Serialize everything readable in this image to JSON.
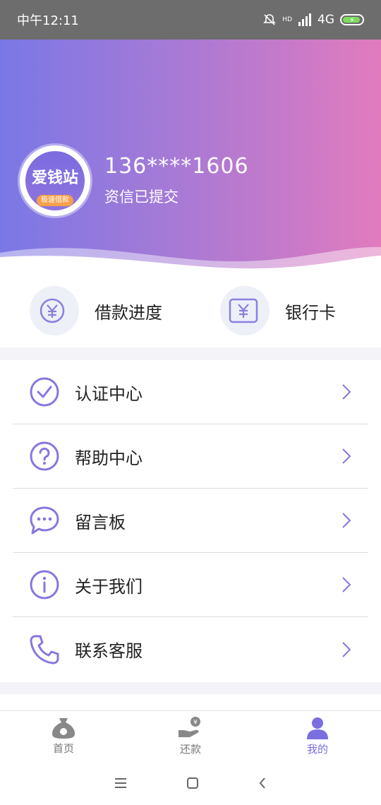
{
  "status_bar": {
    "time": "中午12:11",
    "network": "4G",
    "hd": "HD"
  },
  "profile": {
    "avatar_title": "爱钱站",
    "avatar_subtitle": "极速借款",
    "phone": "136****1606",
    "status": "资信已提交"
  },
  "quick_actions": [
    {
      "label": "借款进度",
      "icon": "yuan-circle-icon"
    },
    {
      "label": "银行卡",
      "icon": "bank-card-icon"
    }
  ],
  "menu": [
    {
      "label": "认证中心",
      "icon": "check-circle-icon"
    },
    {
      "label": "帮助中心",
      "icon": "question-circle-icon"
    },
    {
      "label": "留言板",
      "icon": "chat-bubble-icon"
    },
    {
      "label": "关于我们",
      "icon": "info-circle-icon"
    },
    {
      "label": "联系客服",
      "icon": "phone-icon"
    }
  ],
  "tabs": [
    {
      "label": "首页",
      "icon": "money-bag-icon",
      "active": false
    },
    {
      "label": "还款",
      "icon": "repay-hand-icon",
      "active": false
    },
    {
      "label": "我的",
      "icon": "user-icon",
      "active": true
    }
  ],
  "colors": {
    "accent": "#7a6ee0",
    "gradient_start": "#7a78e6",
    "gradient_end": "#e27bbe"
  }
}
